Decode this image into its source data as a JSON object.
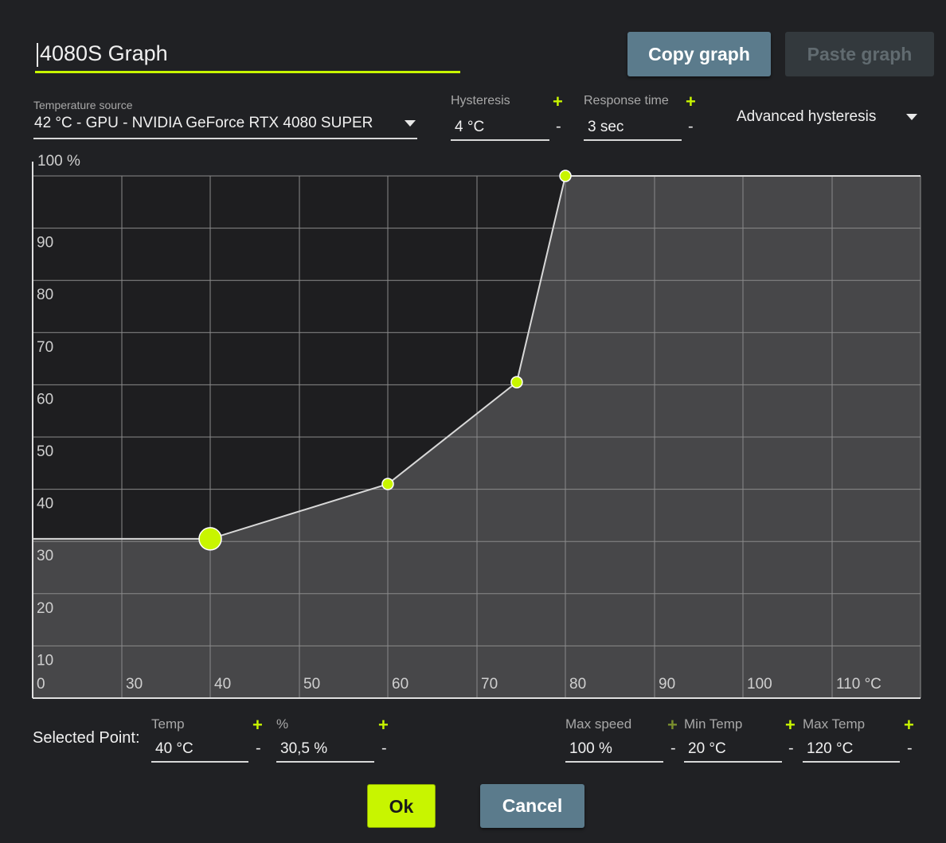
{
  "header": {
    "graph_name": "4080S Graph",
    "copy_label": "Copy graph",
    "paste_label": "Paste graph"
  },
  "settings": {
    "temp_source_label": "Temperature source",
    "temp_source_value": "42 °C - GPU - NVIDIA GeForce RTX 4080 SUPER",
    "hysteresis_label": "Hysteresis",
    "hysteresis_value": "4 °C",
    "response_label": "Response time",
    "response_value": "3 sec",
    "advanced_label": "Advanced hysteresis",
    "plus": "+",
    "minus": "-"
  },
  "chart_data": {
    "type": "line",
    "y_unit_label": "100 %",
    "x_unit_suffix": "°C",
    "x_ticks": [
      "0",
      "30",
      "40",
      "50",
      "60",
      "70",
      "80",
      "90",
      "100",
      "110 °C"
    ],
    "y_ticks": [
      "90",
      "80",
      "70",
      "60",
      "50",
      "40",
      "30",
      "20",
      "10"
    ],
    "ylim": [
      0,
      100
    ],
    "grid": true,
    "points": [
      {
        "x": 40,
        "y": 30.5,
        "selected": true
      },
      {
        "x": 60,
        "y": 41
      },
      {
        "x": 74.5,
        "y": 60.5
      },
      {
        "x": 80,
        "y": 100
      }
    ],
    "colors": {
      "line": "#d8d8d8",
      "fill": "#474749",
      "point": "#c8f500",
      "grid": "#8a8a8a"
    }
  },
  "selected_point": {
    "title": "Selected Point:",
    "temp_label": "Temp",
    "temp_value": "40 °C",
    "pct_label": "%",
    "pct_value": "30,5 %",
    "max_speed_label": "Max speed",
    "max_speed_value": "100 %",
    "min_temp_label": "Min Temp",
    "min_temp_value": "20 °C",
    "max_temp_label": "Max Temp",
    "max_temp_value": "120 °C"
  },
  "footer": {
    "ok_label": "Ok",
    "cancel_label": "Cancel"
  }
}
